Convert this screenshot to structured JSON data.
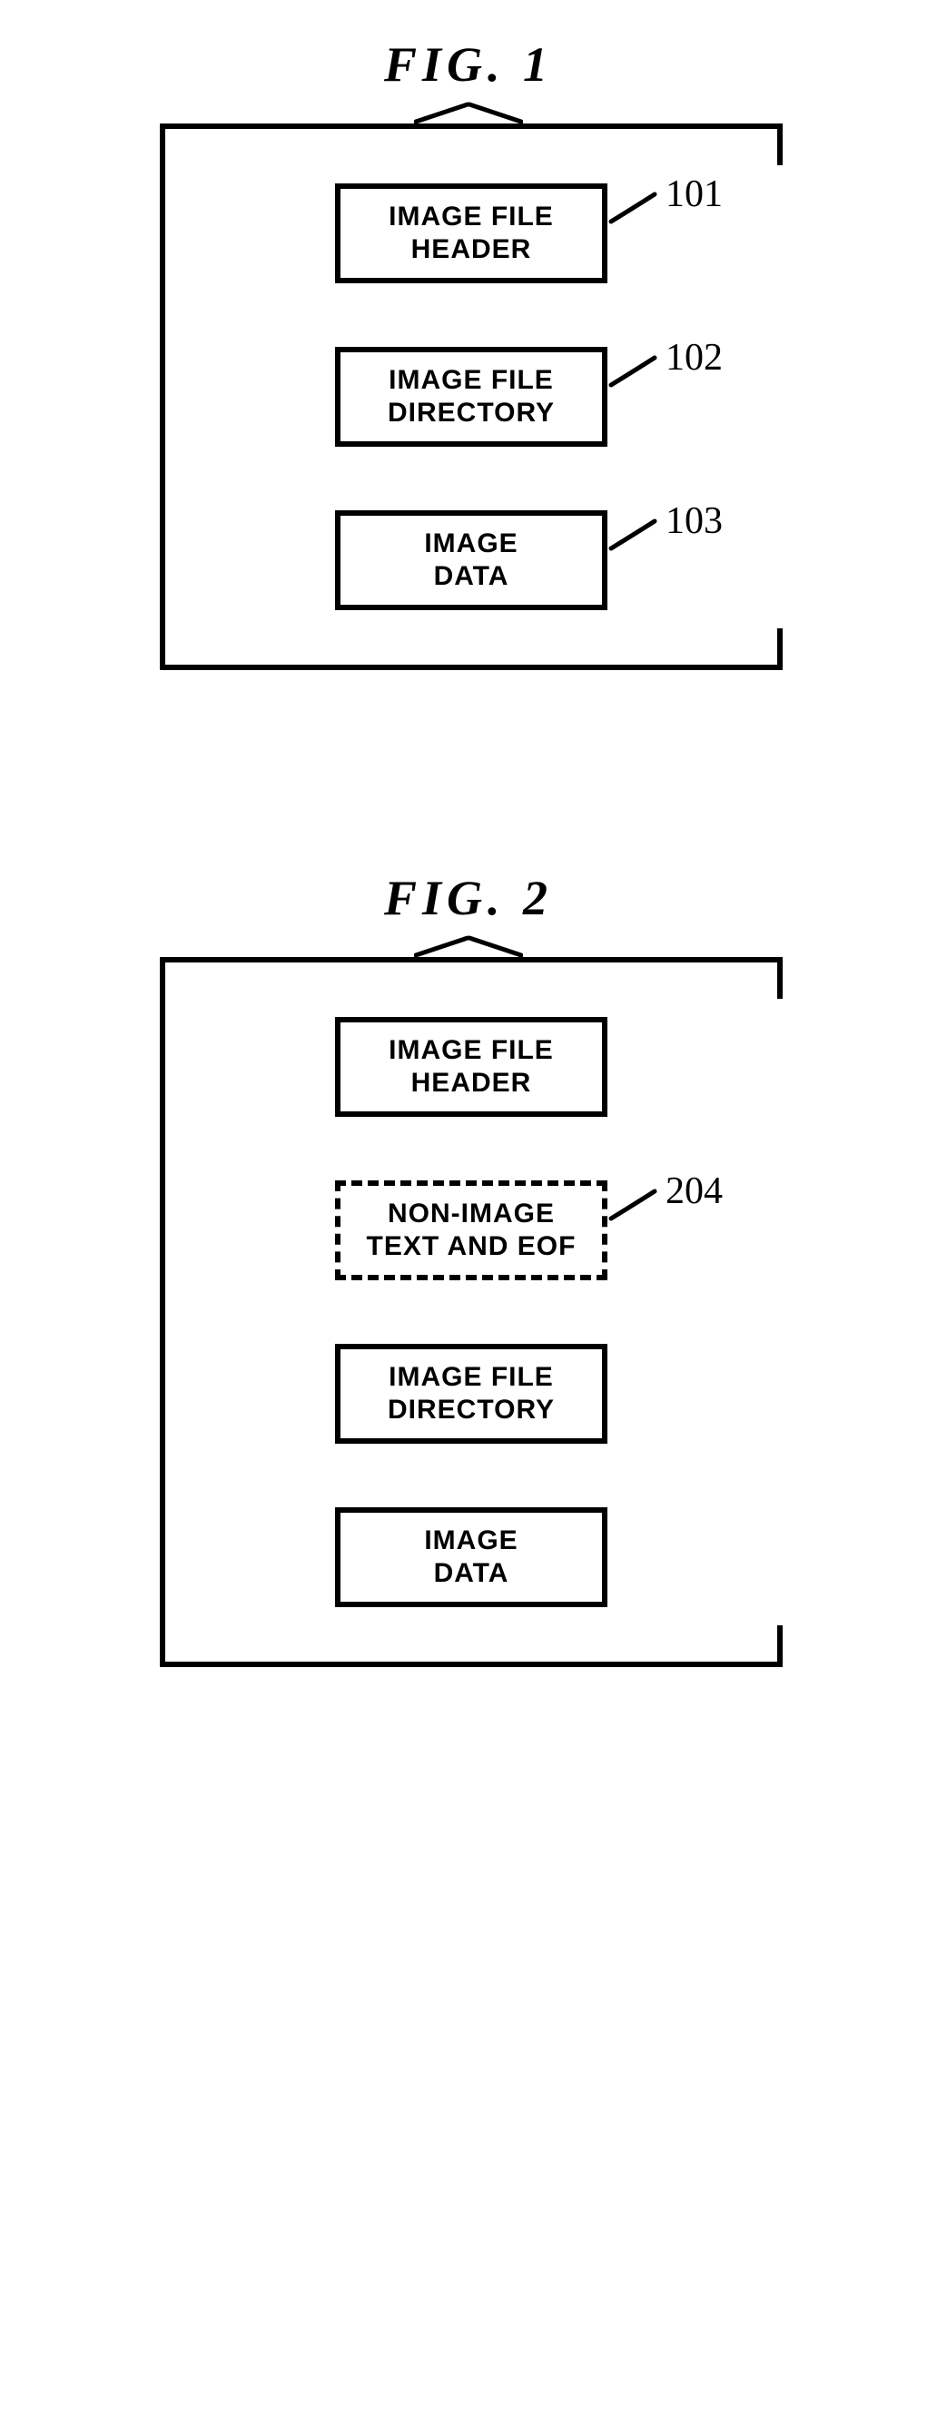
{
  "fig1": {
    "title": "FIG. 1",
    "boxes": [
      {
        "label": "IMAGE FILE\nHEADER",
        "ref": "101",
        "dashed": false
      },
      {
        "label": "IMAGE FILE\nDIRECTORY",
        "ref": "102",
        "dashed": false
      },
      {
        "label": "IMAGE\nDATA",
        "ref": "103",
        "dashed": false
      }
    ]
  },
  "fig2": {
    "title": "FIG. 2",
    "boxes": [
      {
        "label": "IMAGE FILE\nHEADER",
        "ref": "",
        "dashed": false
      },
      {
        "label": "NON-IMAGE\nTEXT AND EOF",
        "ref": "204",
        "dashed": true
      },
      {
        "label": "IMAGE FILE\nDIRECTORY",
        "ref": "",
        "dashed": false
      },
      {
        "label": "IMAGE\nDATA",
        "ref": "",
        "dashed": false
      }
    ]
  }
}
